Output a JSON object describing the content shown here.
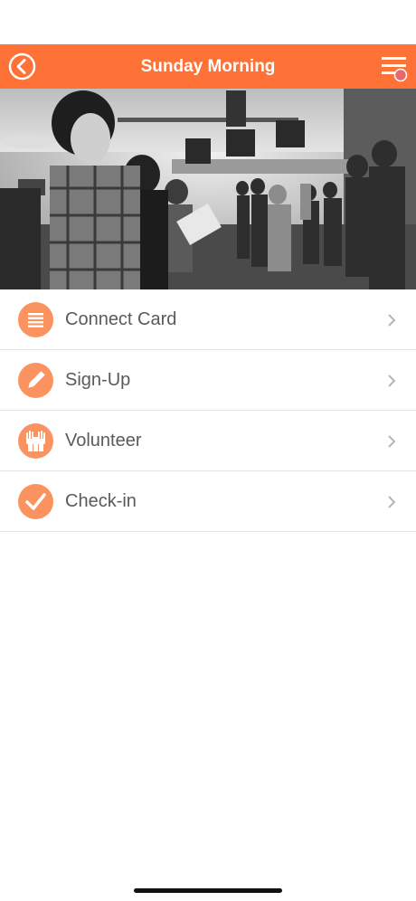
{
  "colors": {
    "accent": "#ff7237",
    "icon_bg": "#fb9361",
    "label": "#5a5a5a",
    "chevron": "#b5b5b5",
    "divider": "#e2e2e2"
  },
  "header": {
    "title": "Sunday Morning",
    "back_icon": "back-arrow-circle-icon",
    "menu_icon": "hamburger-menu-icon"
  },
  "hero": {
    "image": "black-and-white photo of a congregation standing in a church auditorium"
  },
  "menu": {
    "items": [
      {
        "label": "Connect Card",
        "icon": "connect-card-icon"
      },
      {
        "label": "Sign-Up",
        "icon": "pencil-icon"
      },
      {
        "label": "Volunteer",
        "icon": "raised-hands-icon"
      },
      {
        "label": "Check-in",
        "icon": "checkmark-icon"
      }
    ]
  }
}
